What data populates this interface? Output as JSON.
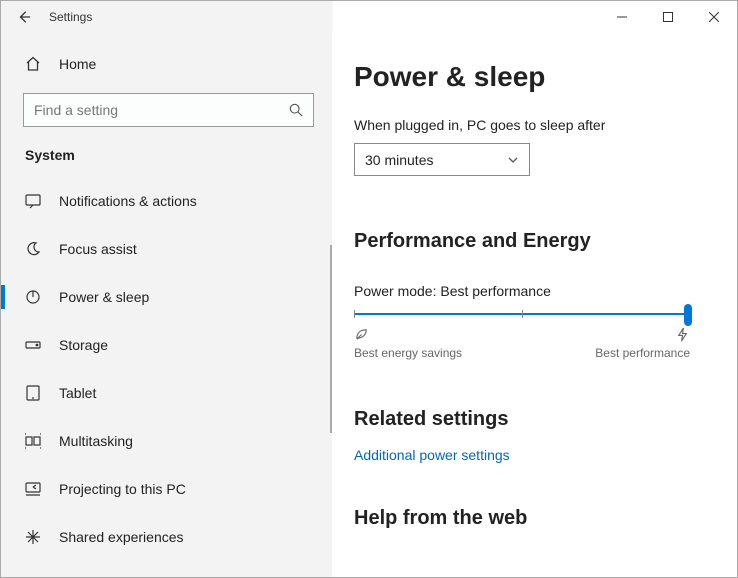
{
  "window": {
    "title": "Settings"
  },
  "sidebar": {
    "home_label": "Home",
    "search_placeholder": "Find a setting",
    "section_label": "System",
    "items": [
      {
        "label": "Notifications & actions",
        "selected": false
      },
      {
        "label": "Focus assist",
        "selected": false
      },
      {
        "label": "Power & sleep",
        "selected": true
      },
      {
        "label": "Storage",
        "selected": false
      },
      {
        "label": "Tablet",
        "selected": false
      },
      {
        "label": "Multitasking",
        "selected": false
      },
      {
        "label": "Projecting to this PC",
        "selected": false
      },
      {
        "label": "Shared experiences",
        "selected": false
      }
    ]
  },
  "main": {
    "page_title": "Power & sleep",
    "sleep": {
      "label": "When plugged in, PC goes to sleep after",
      "value": "30 minutes"
    },
    "performance": {
      "heading": "Performance and Energy",
      "mode_label": "Power mode: Best performance",
      "left_label": "Best energy savings",
      "right_label": "Best performance"
    },
    "related": {
      "heading": "Related settings",
      "link": "Additional power settings"
    },
    "help": {
      "heading": "Help from the web"
    }
  }
}
